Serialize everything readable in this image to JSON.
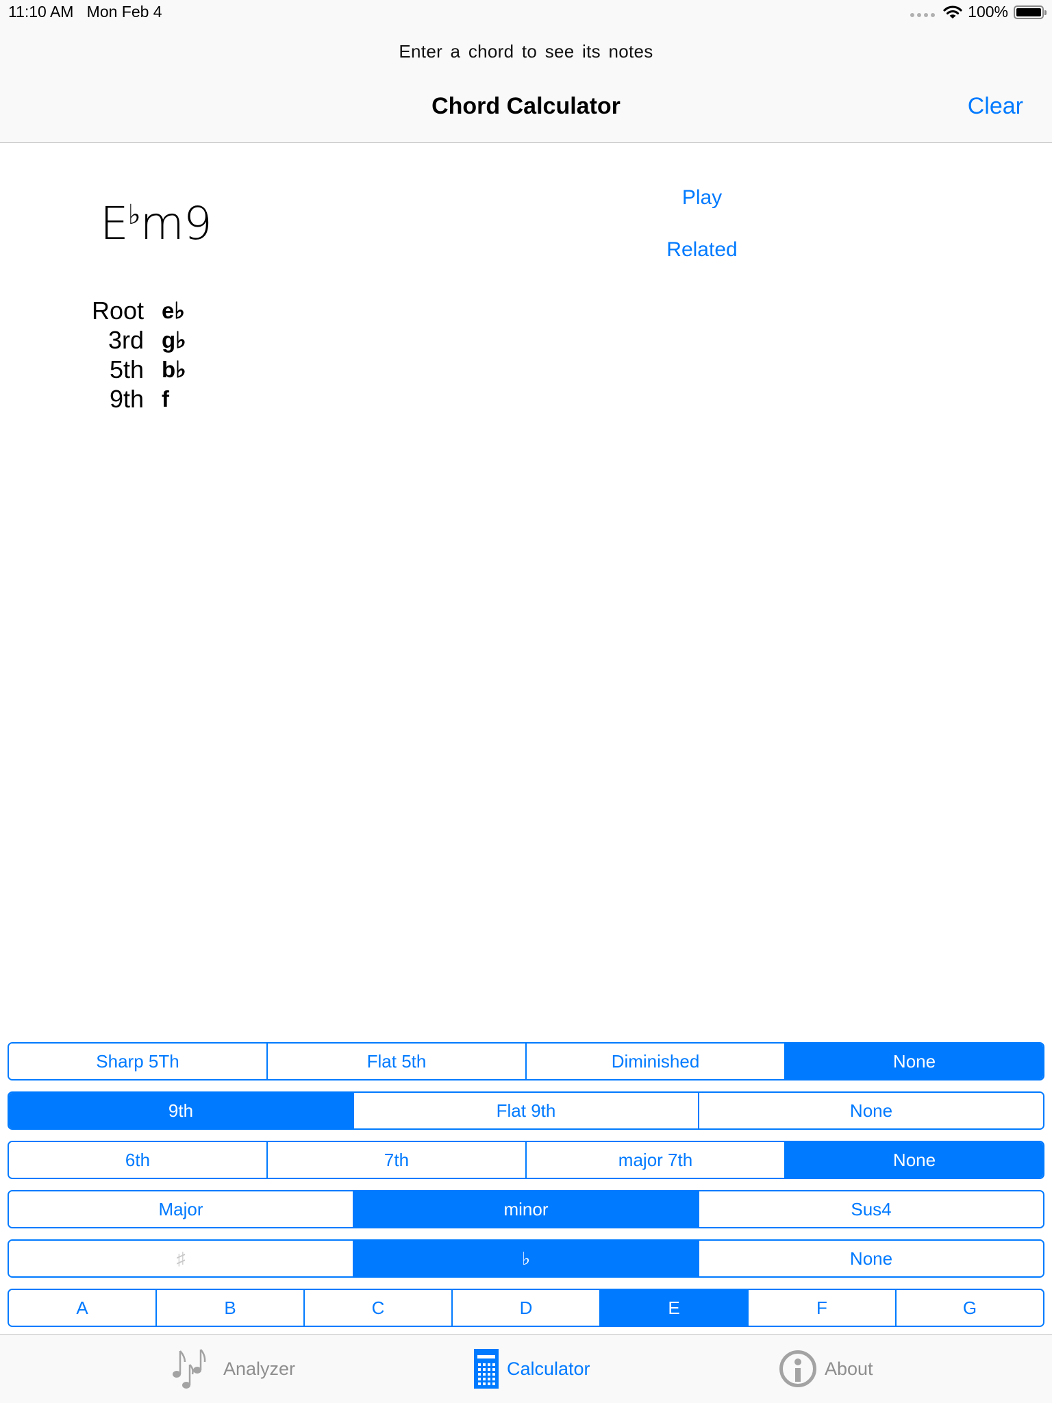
{
  "status_bar": {
    "time": "11:10 AM",
    "date": "Mon Feb 4",
    "battery": "100%",
    "battery_level": 1.0
  },
  "nav": {
    "prompt": "Enter a chord  to see  its notes",
    "title": "Chord Calculator",
    "clear_label": "Clear"
  },
  "chord": {
    "root": "E",
    "accidental": "♭",
    "quality": "m9",
    "full_name": "E♭m9"
  },
  "actions": {
    "play_label": "Play",
    "related_label": "Related"
  },
  "notes": [
    {
      "label": "Root",
      "value": "e♭"
    },
    {
      "label": "3rd",
      "value": "g♭"
    },
    {
      "label": "5th",
      "value": "b♭"
    },
    {
      "label": "9th",
      "value": "f"
    }
  ],
  "segments": {
    "fifth": {
      "options": [
        "Sharp 5Th",
        "Flat 5th",
        "Diminished",
        "None"
      ],
      "selected": "None"
    },
    "ninth": {
      "options": [
        "9th",
        "Flat 9th",
        "None"
      ],
      "selected": "9th"
    },
    "seventh": {
      "options": [
        "6th",
        "7th",
        "major 7th",
        "None"
      ],
      "selected": "None"
    },
    "quality": {
      "options": [
        "Major",
        "minor",
        "Sus4"
      ],
      "selected": "minor"
    },
    "accidental": {
      "options": [
        "♯",
        "♭",
        "None"
      ],
      "selected": "♭",
      "disabled": [
        "♯"
      ]
    },
    "root": {
      "options": [
        "A",
        "B",
        "C",
        "D",
        "E",
        "F",
        "G"
      ],
      "selected": "E"
    }
  },
  "tabs": [
    {
      "label": "Analyzer",
      "icon": "music-notes-icon",
      "active": false
    },
    {
      "label": "Calculator",
      "icon": "calculator-icon",
      "active": true
    },
    {
      "label": "About",
      "icon": "info-icon",
      "active": false
    }
  ],
  "colors": {
    "accent": "#007aff",
    "inactive_tab": "#8e8e8e",
    "bar_background": "#f9f9f9"
  }
}
